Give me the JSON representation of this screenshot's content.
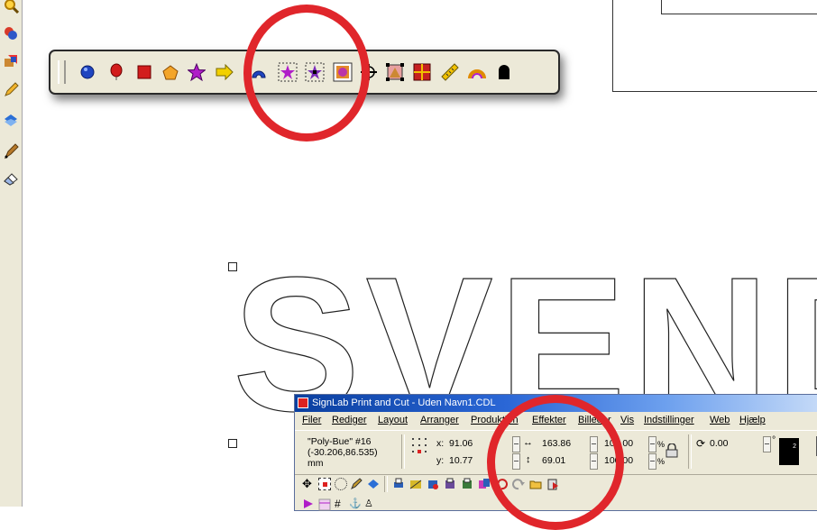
{
  "left_toolbar": {
    "icons": [
      "zoom-icon",
      "shapes-icon",
      "transform-icon",
      "pencil-icon",
      "fill-icon",
      "pen-icon",
      "eraser-icon"
    ]
  },
  "flyout_toolbar": {
    "icons": [
      "circle-icon",
      "balloon-icon",
      "square-icon",
      "pentagon-icon",
      "star-icon",
      "arrow-icon",
      "arc-icon",
      "star-select-icon",
      "star-node-icon",
      "image-select-icon",
      "crosshair-icon",
      "node-box-icon",
      "grid-tile-icon",
      "ruler-icon",
      "dimension-icon",
      "bullet-icon"
    ]
  },
  "canvas": {
    "text_outline": "SVEND"
  },
  "colors": {
    "highlight": "#e0262b",
    "titlebar": "#0a3fa0"
  },
  "app": {
    "title": "SignLab Print and Cut - Uden Navn1.CDL",
    "menu": [
      "Filer",
      "Rediger",
      "Layout",
      "Arranger",
      "Produktion",
      "Effekter",
      "Billeder",
      "Vis",
      "Indstillinger",
      "Web",
      "Hjælp"
    ],
    "selection": {
      "name": "\"Poly-Bue\" #16",
      "coords": "(-30.206,86.535)",
      "unit": "mm"
    },
    "position": {
      "x_label": "x:",
      "x": "91.06",
      "y_label": "y:",
      "y": "10.77"
    },
    "size": {
      "w": "163.86",
      "h": "69.01"
    },
    "scale": {
      "w": "100.00",
      "h": "100.00",
      "unit": "%"
    },
    "rotation": {
      "value": "0.00",
      "unit": "°"
    },
    "layer_badge": "2"
  }
}
